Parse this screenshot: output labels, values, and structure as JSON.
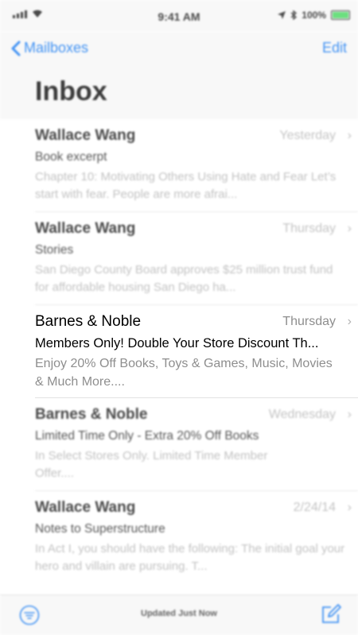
{
  "status_bar": {
    "time": "9:41 AM",
    "battery": "100%",
    "icons": [
      "signal-icon",
      "wifi-icon",
      "location-icon",
      "bluetooth-icon",
      "battery-icon"
    ]
  },
  "nav": {
    "back_label": "Mailboxes",
    "edit_label": "Edit",
    "title": "Inbox"
  },
  "messages": [
    {
      "sender": "Wallace Wang",
      "date": "Yesterday",
      "subject": "Book excerpt",
      "preview": "Chapter 10: Motivating Others Using Hate and Fear Let’s start with fear. People are more afrai..."
    },
    {
      "sender": "Wallace Wang",
      "date": "Thursday",
      "subject": "Stories",
      "preview": "San Diego County Board approves $25 million trust fund for affordable housing San Diego ha..."
    },
    {
      "sender": "Barnes & Noble",
      "date": "Thursday",
      "subject": "Members Only! Double Your Store Discount Th...",
      "preview": "Enjoy 20% Off Books, Toys & Games, Music, Movies & Much More...."
    },
    {
      "sender": "Barnes & Noble",
      "date": "Wednesday",
      "subject": "Limited Time Only - Extra 20% Off Books",
      "preview": "In Select Stores Only. Limited Time Member Offer...."
    },
    {
      "sender": "Wallace Wang",
      "date": "2/24/14",
      "subject": "Notes to Superstructure",
      "preview": "In Act I, you should have the following: The initial goal your hero and villain are pursuing. T..."
    }
  ],
  "toolbar": {
    "status": "Updated Just Now"
  },
  "colors": {
    "accent": "#1a7cf2",
    "bar_background": "#f7f7f7"
  }
}
